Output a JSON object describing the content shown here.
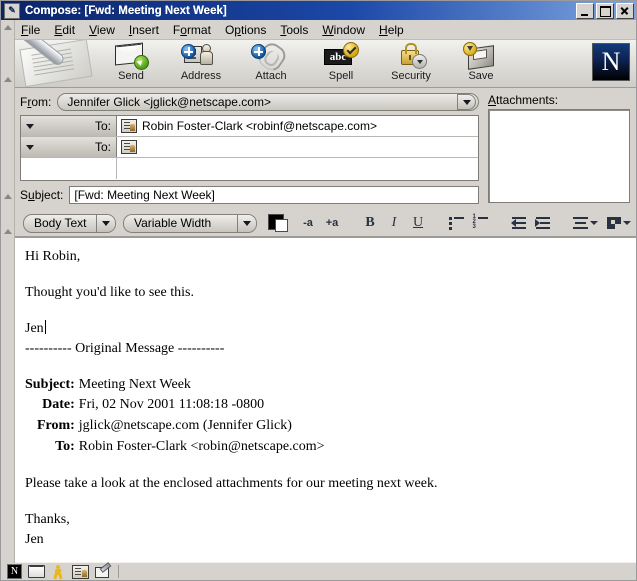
{
  "window": {
    "title": "Compose: [Fwd: Meeting Next Week]",
    "icon": "compose-window-icon",
    "buttons": {
      "minimize": "minimize",
      "maximize": "maximize",
      "close": "close"
    }
  },
  "menubar": {
    "items": [
      {
        "label": "File",
        "accel": "F"
      },
      {
        "label": "Edit",
        "accel": "E"
      },
      {
        "label": "View",
        "accel": "V"
      },
      {
        "label": "Insert",
        "accel": "I"
      },
      {
        "label": "Format",
        "accel": "o"
      },
      {
        "label": "Options",
        "accel": "p"
      },
      {
        "label": "Tools",
        "accel": "T"
      },
      {
        "label": "Window",
        "accel": "W"
      },
      {
        "label": "Help",
        "accel": "H"
      }
    ]
  },
  "toolbar": {
    "buttons": [
      {
        "label": "Send",
        "icon": "send-envelope-icon"
      },
      {
        "label": "Address",
        "icon": "address-book-icon"
      },
      {
        "label": "Attach",
        "icon": "paperclip-icon"
      },
      {
        "label": "Spell",
        "icon": "spellcheck-abc-icon"
      },
      {
        "label": "Security",
        "icon": "padlock-icon"
      },
      {
        "label": "Save",
        "icon": "floppy-save-icon"
      }
    ],
    "logo": "N"
  },
  "compose": {
    "from": {
      "label": "From:",
      "accel": "r",
      "value": "Jennifer Glick <jglick@netscape.com>"
    },
    "recipients": [
      {
        "type": "To:",
        "value": "Robin Foster-Clark <robinf@netscape.com>"
      },
      {
        "type": "To:",
        "value": ""
      }
    ],
    "subject": {
      "label": "Subject:",
      "accel": "u",
      "value": "[Fwd: Meeting Next Week]"
    },
    "attachments": {
      "label": "Attachments:",
      "accel": "A",
      "items": []
    }
  },
  "format_toolbar": {
    "paragraph_style": "Body Text",
    "font_face": "Variable Width",
    "text_color": "#000000",
    "background_color": "#ffffff",
    "buttons": [
      {
        "name": "decrease-font-size",
        "label": "-a"
      },
      {
        "name": "increase-font-size",
        "label": "+a"
      },
      {
        "name": "bold",
        "label": "B"
      },
      {
        "name": "italic",
        "label": "I"
      },
      {
        "name": "underline",
        "label": "U"
      },
      {
        "name": "bulleted-list",
        "label": ""
      },
      {
        "name": "numbered-list",
        "label": ""
      },
      {
        "name": "outdent",
        "label": ""
      },
      {
        "name": "indent",
        "label": ""
      },
      {
        "name": "align",
        "label": ""
      },
      {
        "name": "insert-object",
        "label": ""
      }
    ]
  },
  "message": {
    "greeting": "Hi Robin,",
    "line2": "Thought you'd like to see this.",
    "signature": "Jen",
    "original_separator": "---------- Original Message ----------",
    "original_headers": [
      {
        "key": "Subject:",
        "value": "Meeting Next Week"
      },
      {
        "key": "Date:",
        "value": "Fri, 02 Nov 2001 11:08:18 -0800"
      },
      {
        "key": "From:",
        "value": "jglick@netscape.com (Jennifer Glick)"
      },
      {
        "key": "To:",
        "value": "Robin Foster-Clark <robin@netscape.com>"
      }
    ],
    "original_body": "Please take a look at the enclosed attachments for our meeting next week.",
    "closing": "Thanks,",
    "closing_name": "Jen"
  },
  "statusbar": {
    "icons": [
      {
        "name": "netscape-n-icon",
        "label": "N"
      },
      {
        "name": "mail-envelope-icon",
        "label": ""
      },
      {
        "name": "instant-messenger-icon",
        "label": ""
      },
      {
        "name": "address-book-icon",
        "label": ""
      },
      {
        "name": "composer-icon",
        "label": ""
      }
    ]
  },
  "colors": {
    "titlebar_start": "#0a246a",
    "titlebar_end": "#7ea5e0",
    "window_face": "#d6d3ce",
    "field_background": "#ffffff"
  }
}
